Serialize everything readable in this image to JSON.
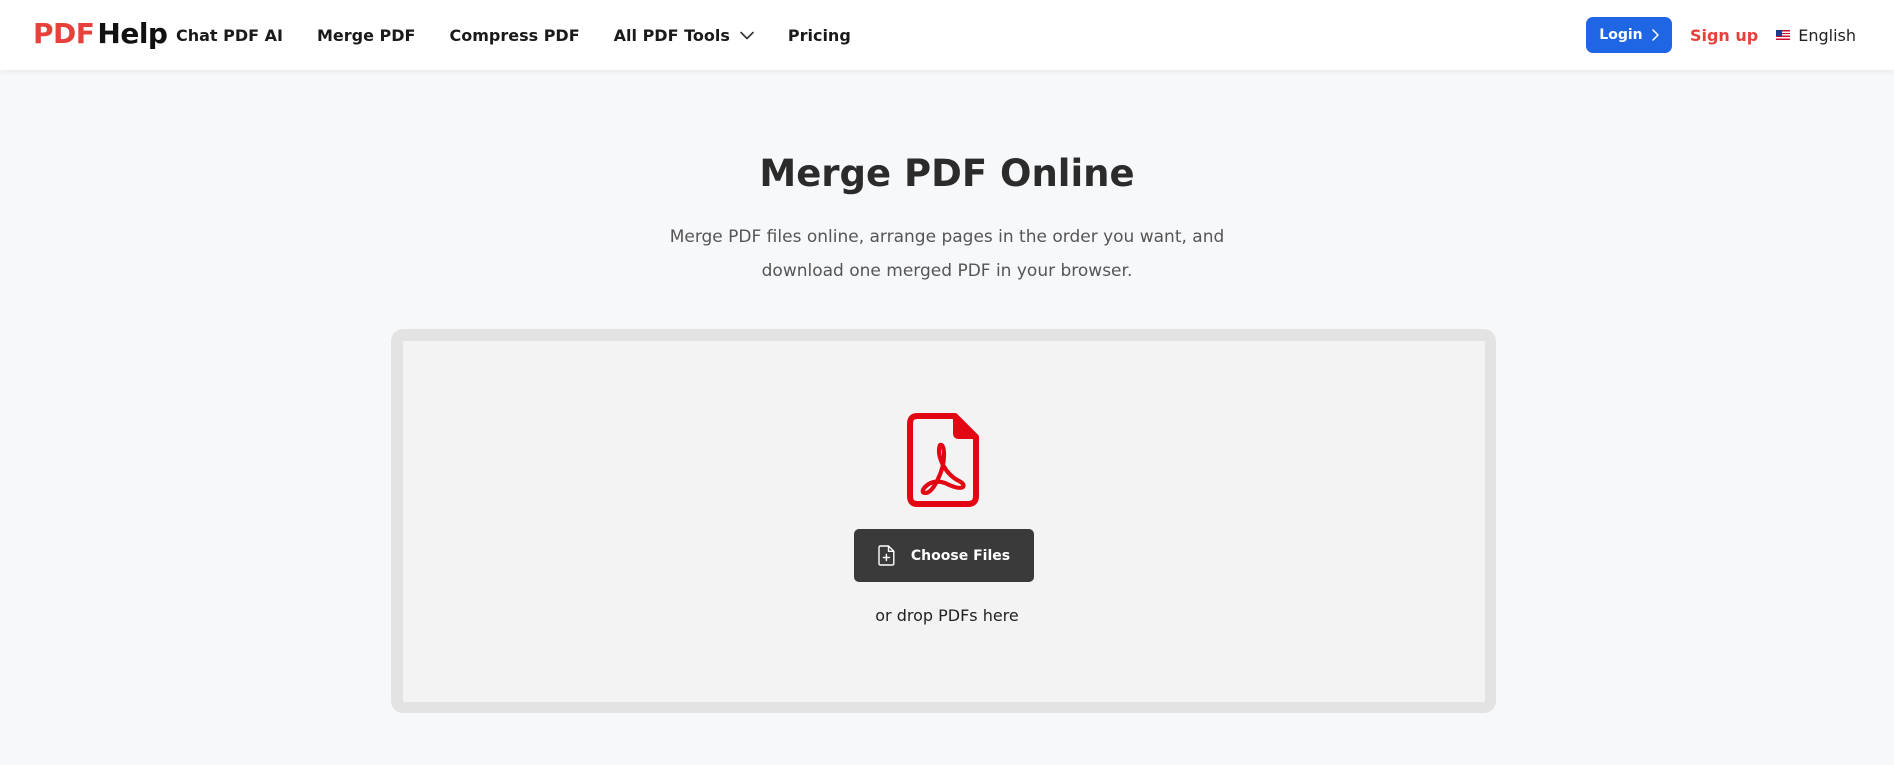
{
  "header": {
    "logo": {
      "part1": "PDF",
      "part2": "Help"
    },
    "nav": [
      {
        "label": "Chat PDF AI"
      },
      {
        "label": "Merge PDF"
      },
      {
        "label": "Compress PDF"
      },
      {
        "label": "All PDF Tools",
        "icon": "chevron-down-icon"
      },
      {
        "label": "Pricing"
      }
    ],
    "login_label": "Login",
    "signup_label": "Sign up",
    "language": "English"
  },
  "hero": {
    "title": "Merge PDF Online",
    "subtitle": "Merge PDF files online, arrange pages in the order you want, and download one merged PDF in your browser."
  },
  "dropzone": {
    "icon": "pdf-file-icon",
    "choose_label": "Choose Files",
    "hint": "or drop PDFs here"
  },
  "colors": {
    "brand_red": "#e8403b",
    "login_blue": "#1f66e5",
    "button_dark": "#3a3a3a",
    "pdf_icon_red": "#e30613"
  }
}
